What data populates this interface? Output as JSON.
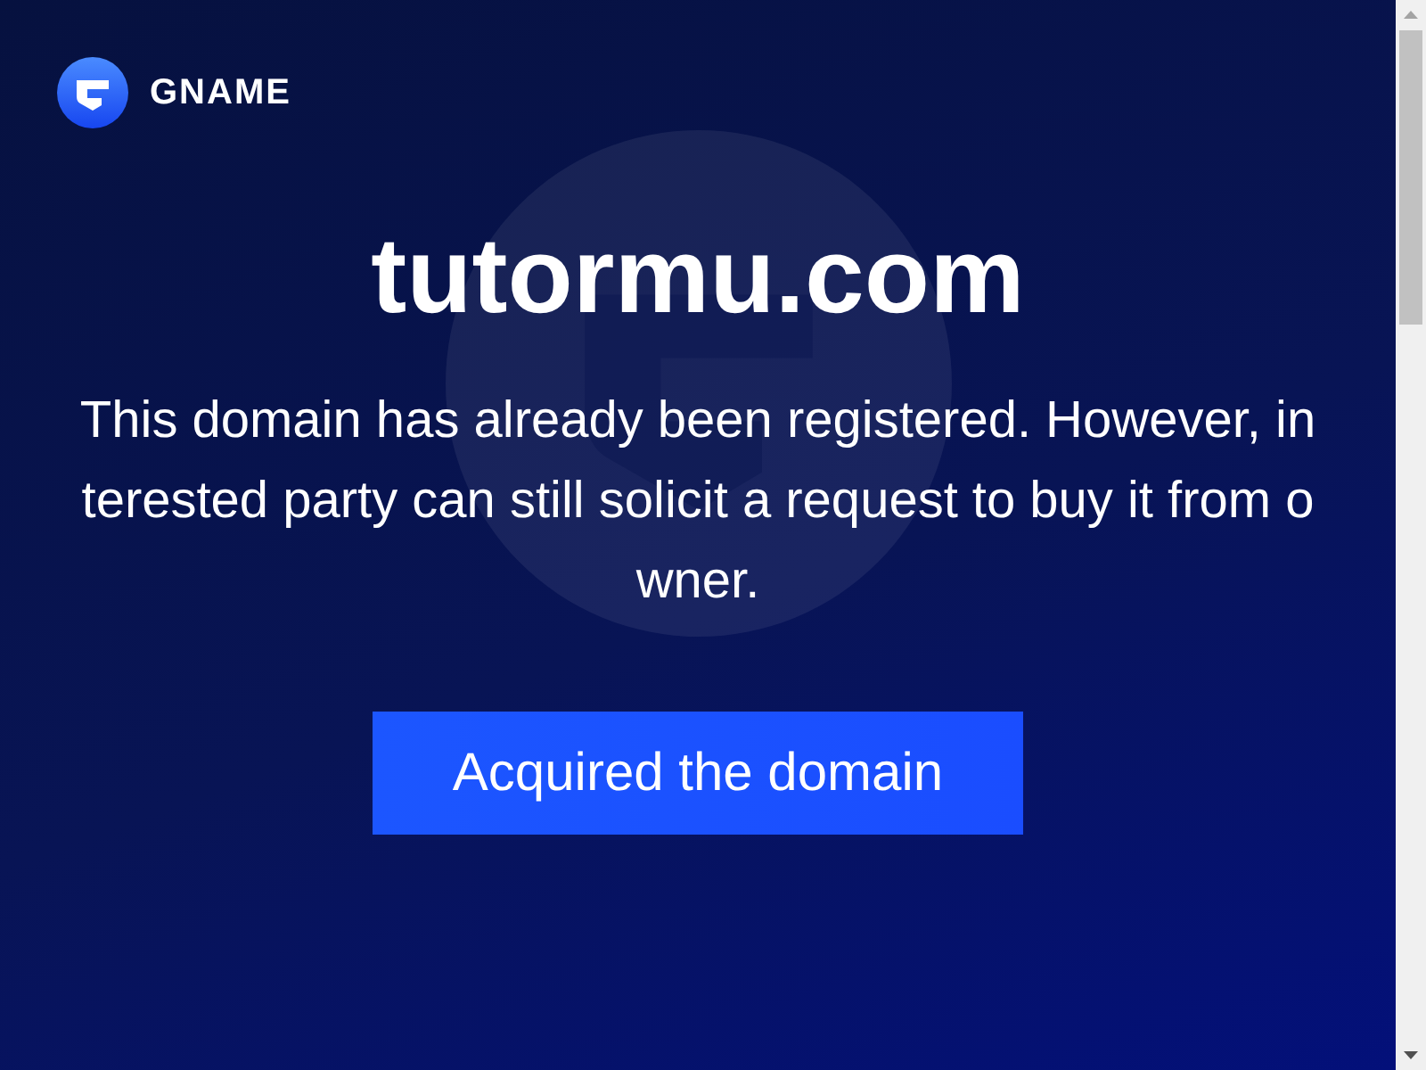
{
  "brand": {
    "name": "GNAME"
  },
  "domain": "tutormu.com",
  "message": "This domain has already been registered. However, interested party can still solicit a request to buy it from owner.",
  "button": {
    "label": "Acquired the domain"
  }
}
